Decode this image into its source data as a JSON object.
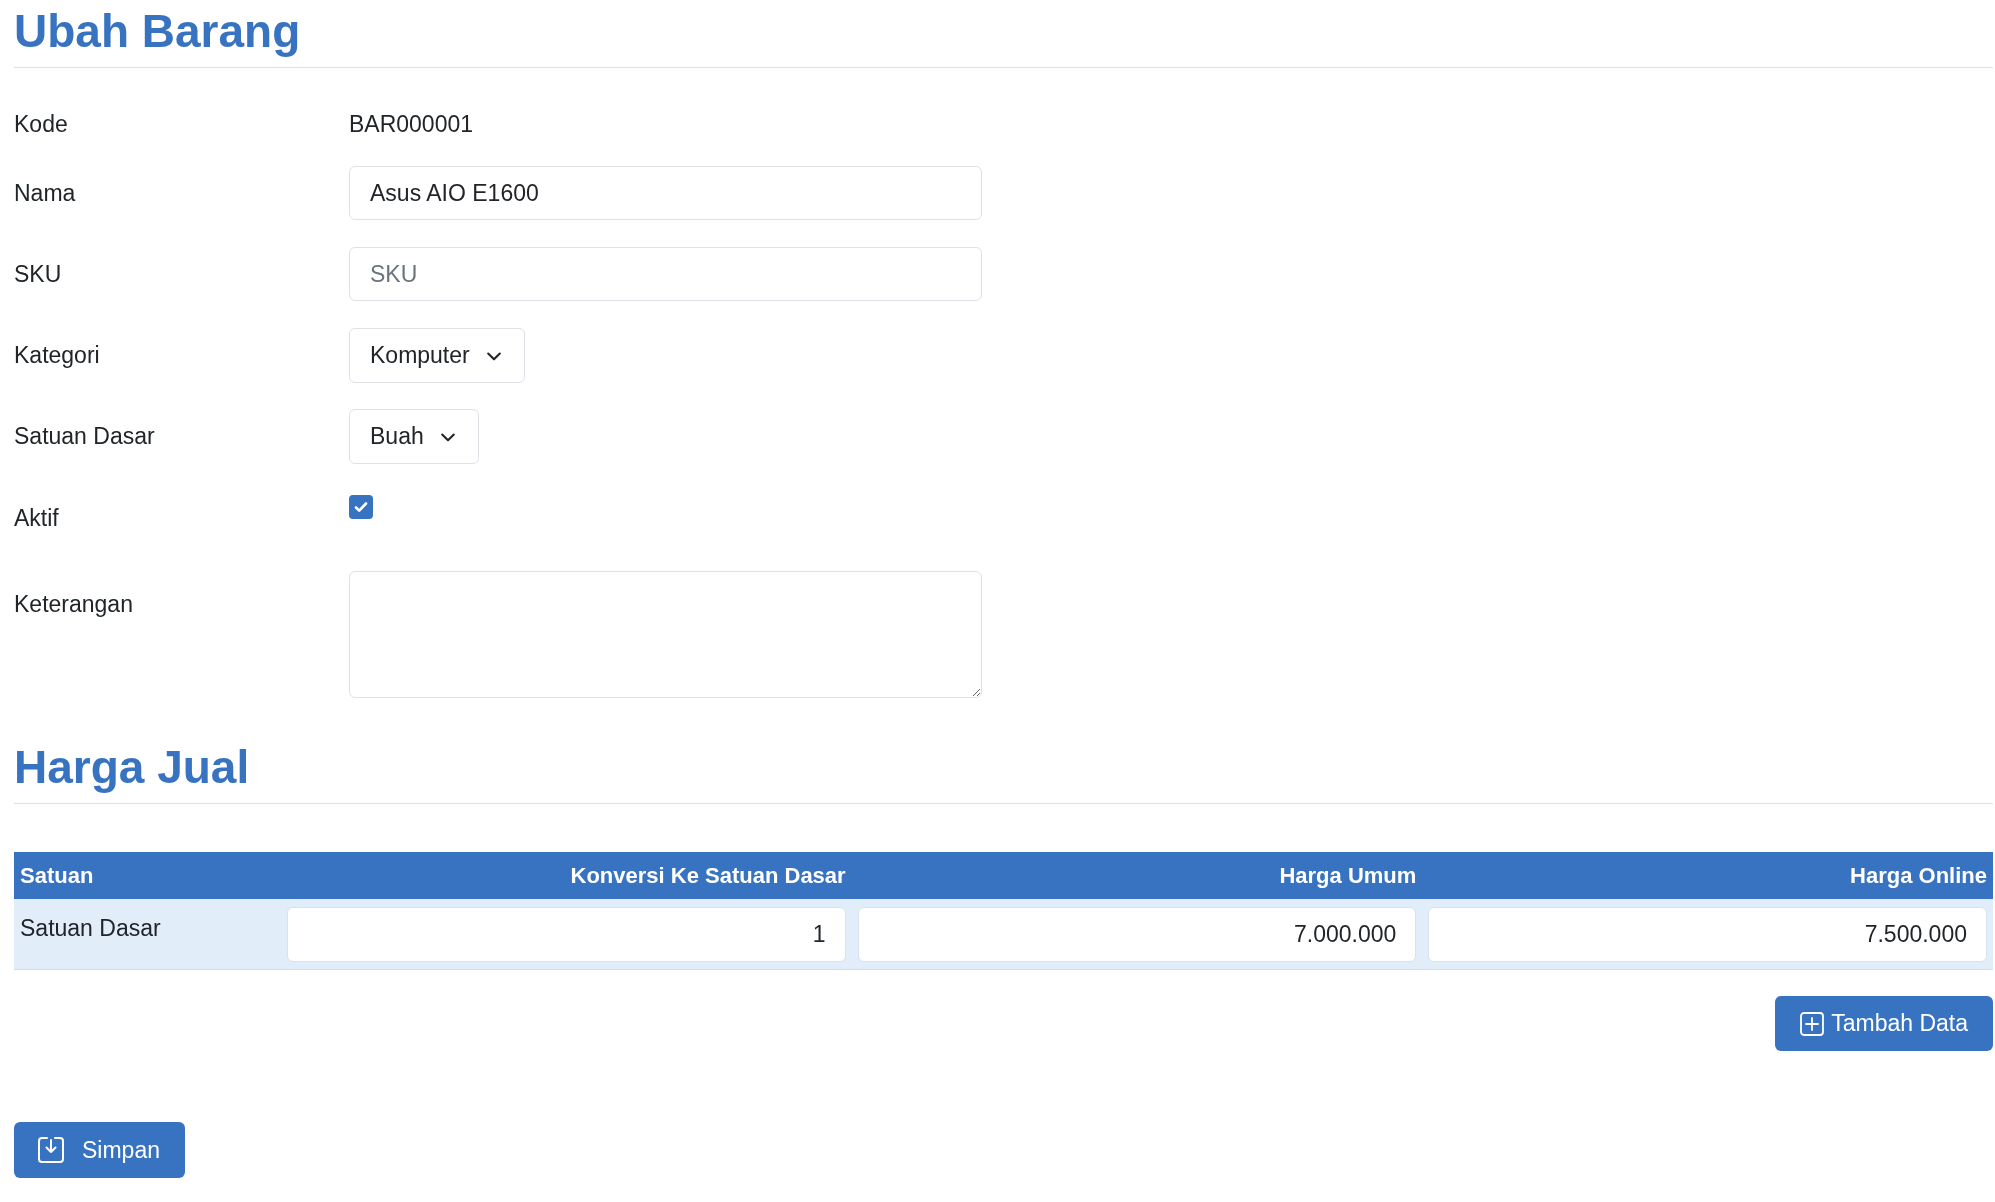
{
  "title": "Ubah Barang",
  "fields": [
    {
      "kind": "text",
      "label": "Kode",
      "value": "BAR000001"
    },
    {
      "kind": "input",
      "label": "Nama",
      "value": "Asus AIO E1600"
    },
    {
      "kind": "input",
      "label": "SKU",
      "placeholder": "SKU"
    },
    {
      "kind": "select",
      "label": "Kategori",
      "value": "Komputer"
    },
    {
      "kind": "select",
      "label": "Satuan Dasar",
      "value": "Buah"
    },
    {
      "kind": "checkbox",
      "label": "Aktif",
      "checked": true
    },
    {
      "kind": "textarea",
      "label": "Keterangan"
    }
  ],
  "price_section": {
    "title": "Harga Jual",
    "table": {
      "columns": [
        "Satuan",
        "Konversi Ke Satuan Dasar",
        "Harga Umum",
        "Harga Online"
      ],
      "rows": [
        {
          "unit": "Satuan Dasar",
          "values": [
            "1",
            "7.000.000",
            "7.500.000"
          ]
        }
      ]
    },
    "add_button": "Tambah Data"
  },
  "save_button": "Simpan"
}
